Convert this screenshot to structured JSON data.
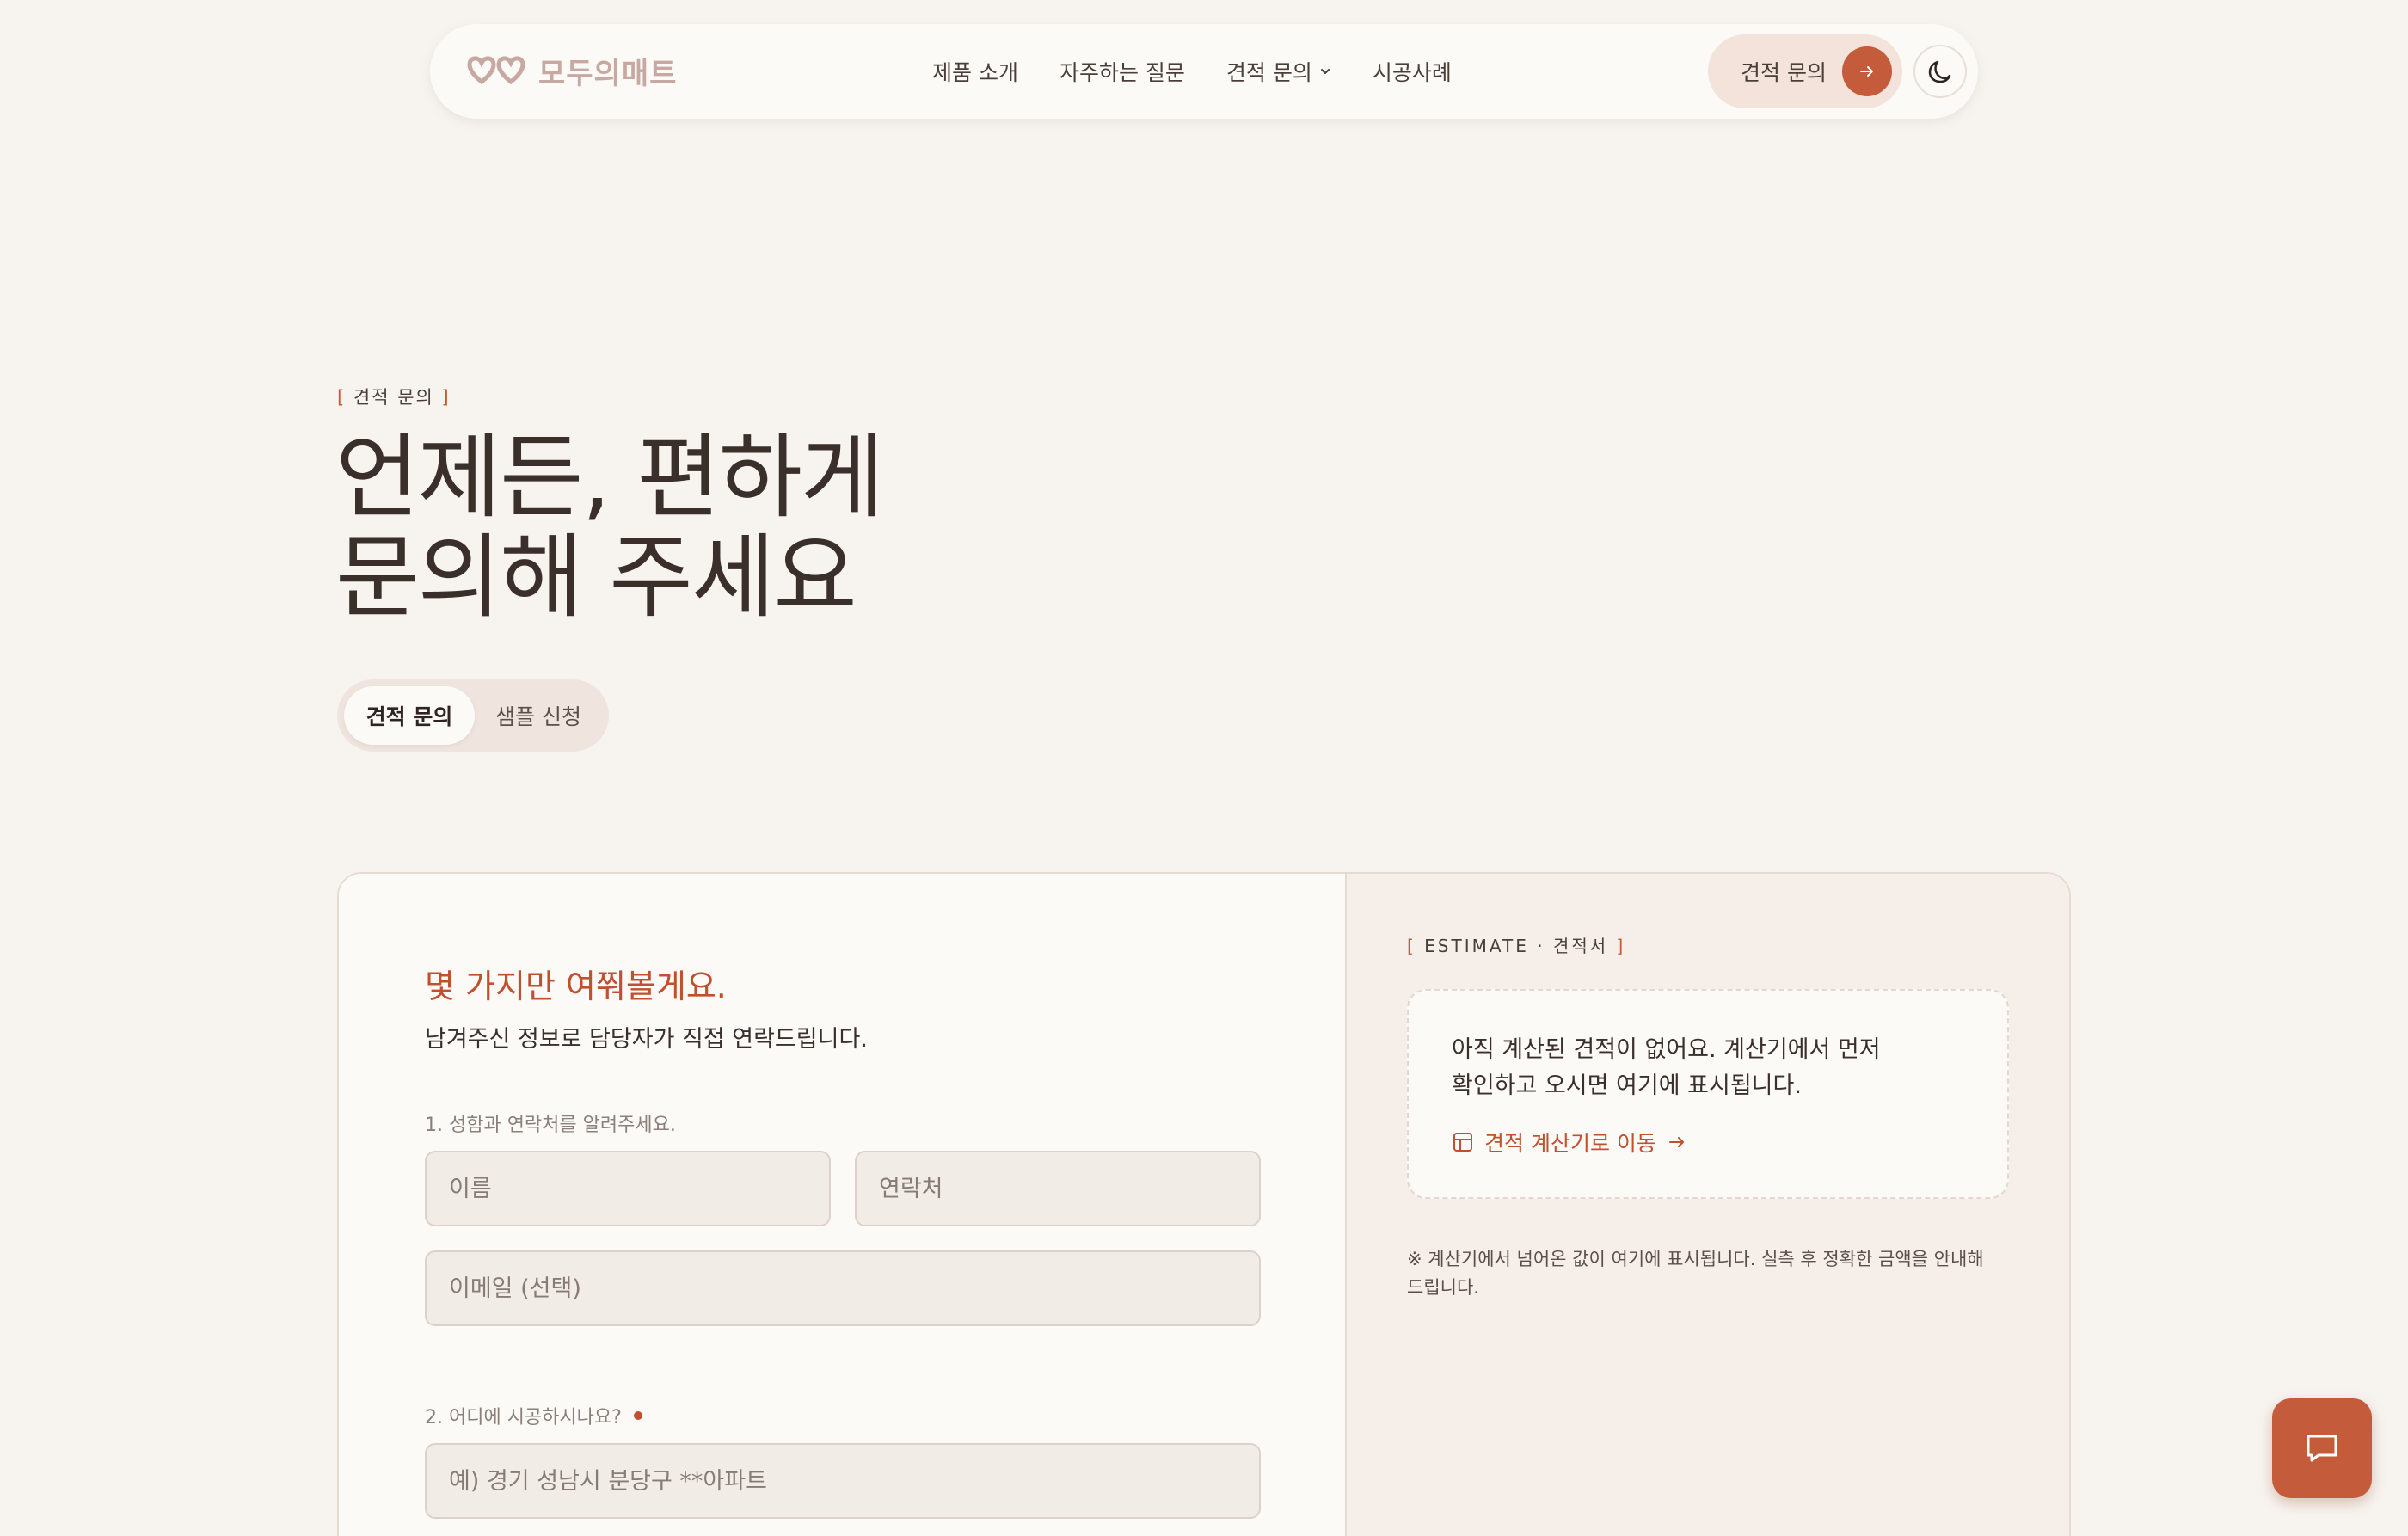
{
  "header": {
    "logo_text": "모두의매트",
    "nav": [
      {
        "label": "제품 소개"
      },
      {
        "label": "자주하는 질문"
      },
      {
        "label": "견적 문의"
      },
      {
        "label": "시공사례"
      }
    ],
    "cta_label": "견적 문의"
  },
  "hero": {
    "eyebrow": "견적 문의",
    "title_line1": "언제든, 편하게",
    "title_line2": "문의해 주세요",
    "tabs": [
      {
        "label": "견적 문의",
        "active": true
      },
      {
        "label": "샘플 신청",
        "active": false
      }
    ]
  },
  "form": {
    "title": "몇 가지만 여쭤볼게요.",
    "subtitle": "남겨주신 정보로 담당자가 직접 연락드립니다.",
    "q1_label": "1. 성함과 연락처를 알려주세요.",
    "name_placeholder": "이름",
    "phone_placeholder": "연락처",
    "email_placeholder": "이메일 (선택)",
    "q2_label": "2. 어디에 시공하시나요?",
    "address_placeholder": "예) 경기 성남시 분당구 **아파트"
  },
  "estimate": {
    "eyebrow": "ESTIMATE · 견적서",
    "empty_message_line1": "아직 계산된 견적이 없어요. 계산기에서 먼저",
    "empty_message_line2": "확인하고 오시면 여기에 표시됩니다.",
    "link_label": "견적 계산기로 이동",
    "note_line1": "※ 계산기에서 넘어온 값이 여기에 표시됩니다. 실측 후 정확한 금액을 안내해",
    "note_line2": "드립니다."
  },
  "colors": {
    "accent": "#c45c3b",
    "background": "#f7f4f0",
    "panel": "#f6efe9",
    "logo": "#c8a9a2"
  },
  "icons": {
    "logo": "double-heart-logo-icon",
    "nav_dropdown": "chevron-down-icon",
    "cta": "arrow-right-icon",
    "theme": "moon-icon",
    "calculator": "calculator-icon",
    "chat": "chat-bubble-icon"
  }
}
